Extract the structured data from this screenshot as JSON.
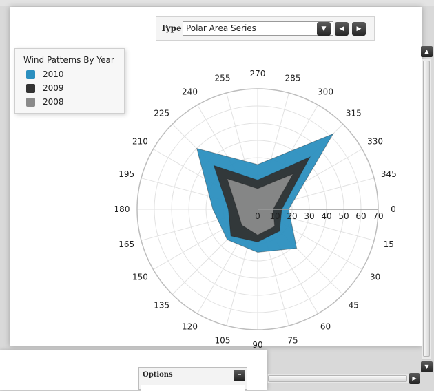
{
  "toolbar": {
    "type_label": "Type",
    "selected_type": "Polar Area Series",
    "dropdown_icon": "chevron-down-icon",
    "prev_icon": "chevron-left-icon",
    "next_icon": "chevron-right-icon"
  },
  "legend": {
    "title": "Wind Patterns By Year",
    "items": [
      {
        "label": "2010",
        "color": "#2b8fbf"
      },
      {
        "label": "2009",
        "color": "#333333"
      },
      {
        "label": "2008",
        "color": "#8a8a8a"
      }
    ]
  },
  "chart_data": {
    "type": "polar-area",
    "title": "",
    "angle_ticks": [
      0,
      15,
      30,
      45,
      60,
      75,
      90,
      105,
      120,
      135,
      150,
      165,
      180,
      195,
      210,
      225,
      240,
      255,
      270,
      285,
      300,
      315,
      330,
      345
    ],
    "radius_ticks": [
      0,
      10,
      20,
      30,
      40,
      50,
      60,
      70
    ],
    "radius_range": [
      0,
      70
    ],
    "angles": [
      0,
      45,
      90,
      135,
      180,
      225,
      270,
      315
    ],
    "series": [
      {
        "name": "2010",
        "color": "#2b8fbf",
        "values": [
          18,
          32,
          25,
          25,
          26,
          50,
          26,
          62
        ]
      },
      {
        "name": "2009",
        "color": "#333333",
        "values": [
          14,
          18,
          19,
          22,
          17,
          36,
          17,
          43
        ]
      },
      {
        "name": "2008",
        "color": "#8a8a8a",
        "values": [
          9,
          14,
          15,
          13,
          12,
          25,
          12,
          29
        ]
      }
    ]
  },
  "options": {
    "title": "Options",
    "collapse_icon": "minus-icon"
  },
  "scrollbars": {
    "up_icon": "scroll-up-icon",
    "down_icon": "scroll-down-icon",
    "right_icon": "scroll-right-icon"
  }
}
